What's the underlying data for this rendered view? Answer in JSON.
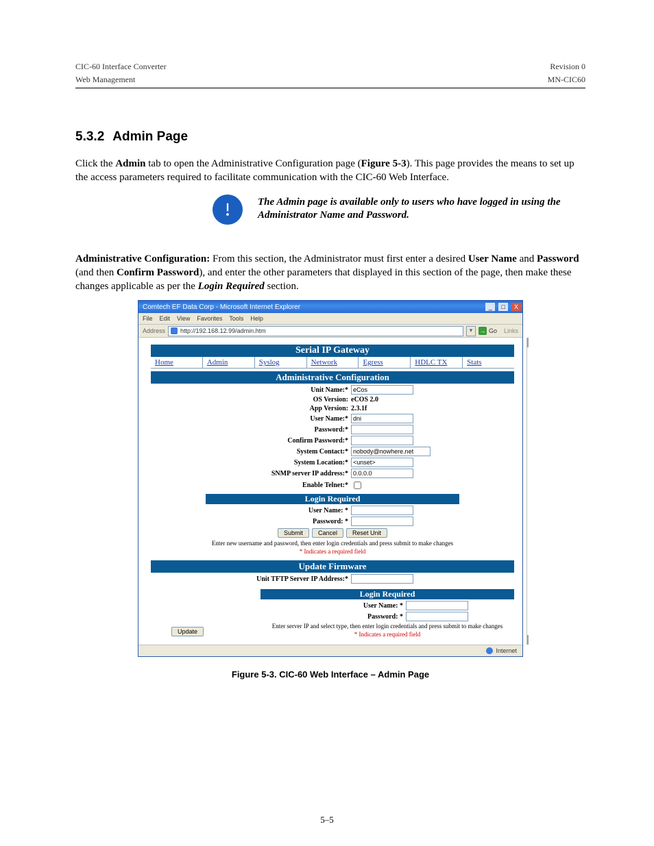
{
  "header": {
    "left": "CIC-60 Interface Converter",
    "right": "Revision 0",
    "left2": "Web Management",
    "right2": "MN-CIC60"
  },
  "section": {
    "number": "5.3.2",
    "title": "Admin Page"
  },
  "body": {
    "para1a": "Click the ",
    "para1b": "Admin",
    "para1c": " tab to open the Administrative Configuration page (",
    "para1d": "Figure 5-3",
    "para1e": "). This page provides the means to set up the access parameters required to facilitate communication with the CIC-60 Web Interface.",
    "callout": "The Admin page is available only to users who have logged in using the Administrator Name and Password.",
    "para2a": "Administrative Configuration:",
    "para2b": " From this section, the Administrator must first enter a desired ",
    "para2c": "User Name",
    "para2d": " and ",
    "para2e": "Password",
    "para2f": " (and then ",
    "para2g": "Confirm Password",
    "para2h": "), and enter the other parameters that displayed in this section of the page, then make these changes applicable as per the ",
    "para2i": "Login Required",
    "para2j": " section."
  },
  "screenshot": {
    "title": "Comtech EF Data Corp - Microsoft Internet Explorer",
    "menus": [
      "File",
      "Edit",
      "View",
      "Favorites",
      "Tools",
      "Help"
    ],
    "address_label": "Address",
    "address_value": "http://192.168.12.99/admin.htm",
    "go_label": "Go",
    "links_label": "Links",
    "banner": "Serial IP Gateway",
    "tabs": [
      "Home",
      "Admin",
      "Syslog",
      "Network",
      "Egress",
      "HDLC TX",
      "Stats"
    ],
    "band_admin": "Administrative Configuration",
    "fields": {
      "unit_name_lbl": "Unit Name:*",
      "unit_name_val": "eCos",
      "os_version_lbl": "OS Version:",
      "os_version_val": "eCOS 2.0",
      "app_version_lbl": "App Version:",
      "app_version_val": "2.3.1f",
      "user_name_lbl": "User Name:*",
      "user_name_val": "dni",
      "password_lbl": "Password:*",
      "confirm_password_lbl": "Confirm Password:*",
      "system_contact_lbl": "System Contact:*",
      "system_contact_val": "nobody@nowhere.net",
      "system_location_lbl": "System Location:*",
      "system_location_val": "<unset>",
      "snmp_ip_lbl": "SNMP server IP address:*",
      "snmp_ip_val": "0.0.0.0",
      "enable_telnet_lbl": "Enable Telnet:*"
    },
    "band_login": "Login Required",
    "login": {
      "user_lbl": "User Name: *",
      "pass_lbl": "Password: *"
    },
    "buttons": {
      "submit": "Submit",
      "cancel": "Cancel",
      "reset": "Reset Unit",
      "update": "Update"
    },
    "instr1": "Enter new username and password, then enter login credentials and press submit to make changes",
    "instr_req": "* Indicates a required field",
    "band_update": "Update Firmware",
    "tftp_lbl": "Unit TFTP Server IP Address:*",
    "instr2": "Enter server IP and select type, then enter login credentials and press submit to make changes",
    "status_zone": "Internet"
  },
  "figure_caption": "Figure 5-3. CIC-60 Web Interface – Admin Page",
  "page_number": "5–5"
}
